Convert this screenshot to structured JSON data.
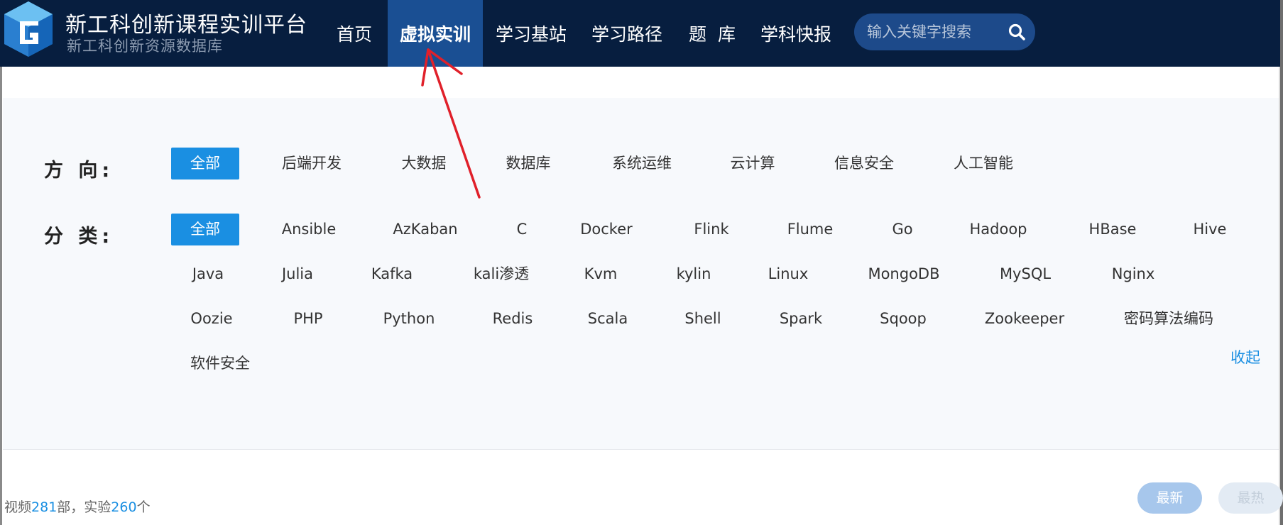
{
  "brand": {
    "title": "新工科创新课程实训平台",
    "subtitle": "新工科创新资源数据库"
  },
  "nav": {
    "items": [
      {
        "label": "首页"
      },
      {
        "label": "虚拟实训",
        "active": true
      },
      {
        "label": "学习基站"
      },
      {
        "label": "学习路径"
      },
      {
        "label": "题  库"
      },
      {
        "label": "学科快报"
      }
    ]
  },
  "search": {
    "placeholder": "输入关键字搜索"
  },
  "filters": {
    "direction_label": "方 向:",
    "direction_items": [
      "全部",
      "后端开发",
      "大数据",
      "数据库",
      "系统运维",
      "云计算",
      "信息安全",
      "人工智能"
    ],
    "category_label": "分 类:",
    "category_items": [
      "全部",
      "Ansible",
      "AzKaban",
      "C",
      "Docker",
      "Flink",
      "Flume",
      "Go",
      "Hadoop",
      "HBase",
      "Hive",
      "Java",
      "Julia",
      "Kafka",
      "kali渗透",
      "Kvm",
      "kylin",
      "Linux",
      "MongoDB",
      "MySQL",
      "Nginx",
      "Oozie",
      "PHP",
      "Python",
      "Redis",
      "Scala",
      "Shell",
      "Spark",
      "Sqoop",
      "Zookeeper",
      "密码算法编码",
      "软件安全"
    ],
    "collapse_label": "收起"
  },
  "stats": {
    "video_prefix": "视频",
    "video_count": "281",
    "video_suffix": "部，实验",
    "lab_count": "260",
    "lab_suffix": "个"
  },
  "sort": {
    "newest": "最新",
    "hottest": "最热"
  },
  "colors": {
    "header_bg": "#071e3f",
    "nav_active_bg": "#1a4f93",
    "accent": "#1a8fe2",
    "panel_bg": "#f7f9fc",
    "annotation_arrow": "#e0202a"
  },
  "icons": {
    "logo": "cube-g-logo",
    "search": "search-icon",
    "annotation": "red-arrow-annotation"
  }
}
